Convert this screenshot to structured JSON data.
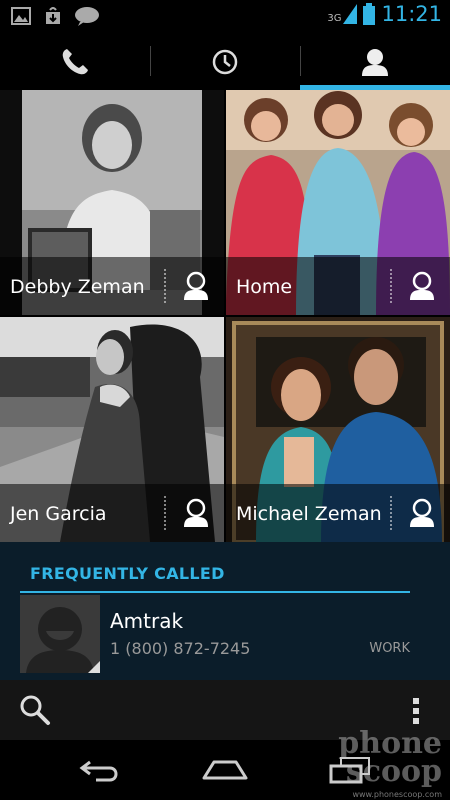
{
  "status_bar": {
    "network": "3G",
    "time": "11:21",
    "left_icons": [
      "gallery-icon",
      "download-icon",
      "talk-icon"
    ],
    "talk_label": "talk"
  },
  "tabs": [
    {
      "name": "phone-tab",
      "icon": "phone-icon",
      "selected": false
    },
    {
      "name": "call-log-tab",
      "icon": "clock-icon",
      "selected": false
    },
    {
      "name": "contacts-tab",
      "icon": "person-icon",
      "selected": true
    }
  ],
  "favorites": [
    {
      "name": "Debby Zeman"
    },
    {
      "name": "Home"
    },
    {
      "name": "Jen Garcia"
    },
    {
      "name": "Michael Zeman"
    }
  ],
  "frequently_called": {
    "title": "FREQUENTLY CALLED",
    "items": [
      {
        "name": "Amtrak",
        "number": "1 (800) 872-7245",
        "type": "WORK"
      }
    ]
  },
  "watermark": {
    "line1": "phone",
    "line2": "scoop",
    "credit": "www.phonescoop.com"
  },
  "colors": {
    "accent": "#33b5e5",
    "background": "#000000",
    "section_bg": "#0b1d2a"
  }
}
